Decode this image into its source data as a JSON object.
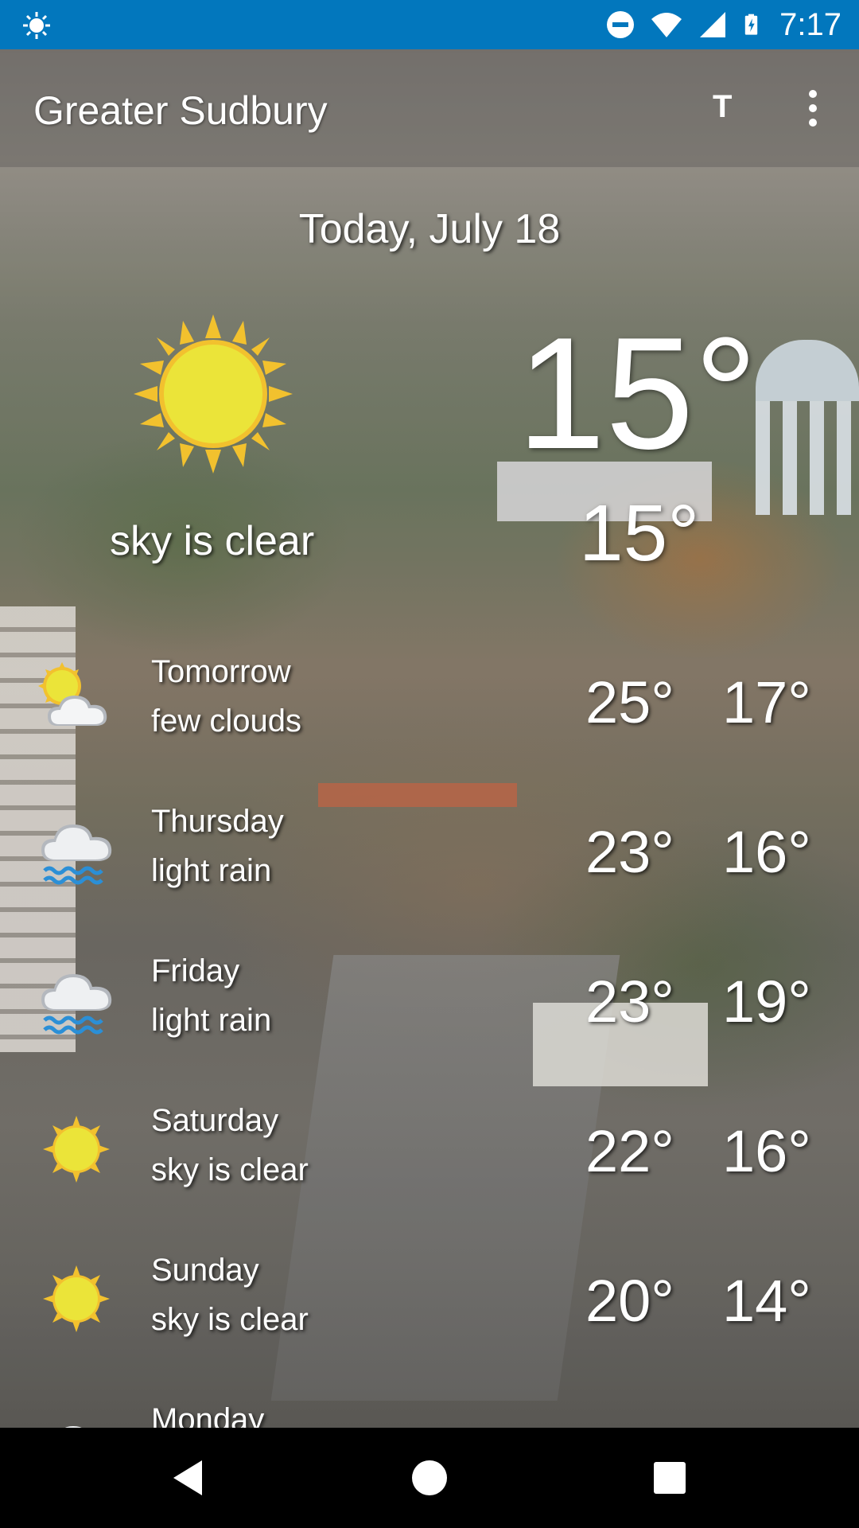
{
  "status_bar": {
    "time": "7:17",
    "left_icon": "weather-sun-icon",
    "icons": [
      "do-not-disturb-icon",
      "wifi-icon",
      "cell-signal-icon",
      "battery-charging-icon"
    ]
  },
  "app_bar": {
    "title": "Greater Sudbury",
    "action_label": "T",
    "menu_icon": "more-vert-icon"
  },
  "current": {
    "date": "Today, July 18",
    "temp": "15°",
    "temp_secondary": "15°",
    "description": "sky is clear",
    "icon": "sun-icon"
  },
  "forecast": [
    {
      "day": "Tomorrow",
      "desc": "few clouds",
      "high": "25°",
      "low": "17°",
      "icon": "partly-cloudy-icon"
    },
    {
      "day": "Thursday",
      "desc": "light rain",
      "high": "23°",
      "low": "16°",
      "icon": "rain-cloud-icon"
    },
    {
      "day": "Friday",
      "desc": "light rain",
      "high": "23°",
      "low": "19°",
      "icon": "rain-cloud-icon"
    },
    {
      "day": "Saturday",
      "desc": "sky is clear",
      "high": "22°",
      "low": "16°",
      "icon": "sun-icon"
    },
    {
      "day": "Sunday",
      "desc": "sky is clear",
      "high": "20°",
      "low": "14°",
      "icon": "sun-icon"
    },
    {
      "day": "Monday",
      "desc": "",
      "high": "",
      "low": "",
      "icon": "cloud-icon"
    }
  ],
  "nav_bar": {
    "back_icon": "nav-back-icon",
    "home_icon": "nav-home-icon",
    "recent_icon": "nav-recent-apps-icon"
  },
  "colors": {
    "status_bar": "#0277bd",
    "sun_yellow": "#f5e93b",
    "sun_ray": "#f2c12e"
  }
}
